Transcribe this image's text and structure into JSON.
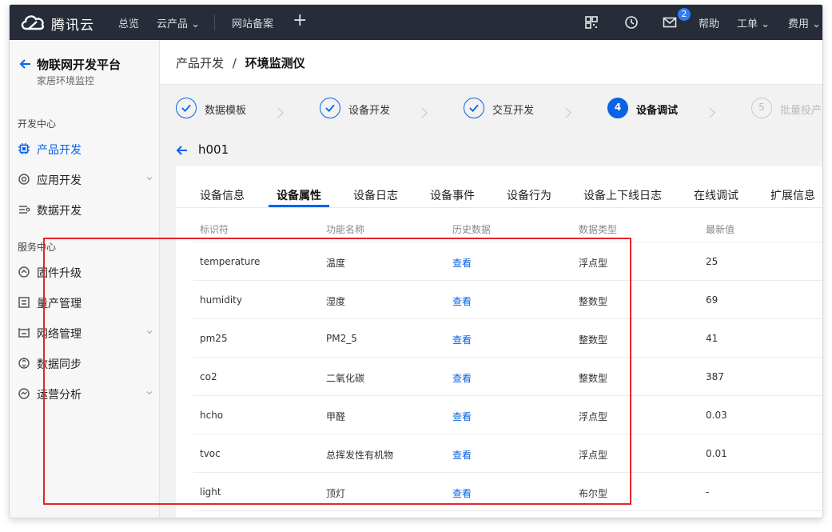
{
  "topbar": {
    "brand": "腾讯云",
    "nav": [
      {
        "label": "总览"
      },
      {
        "label": "云产品 ⌄"
      },
      {
        "label": "网站备案"
      }
    ],
    "badge_count": "2",
    "help": "帮助",
    "ticket": "工单 ⌄",
    "billing": "费用 ⌄"
  },
  "sidebar": {
    "title": "物联网开发平台",
    "subtitle": "家居环境监控",
    "dev_section": "开发中心",
    "service_section": "服务中心",
    "items": [
      {
        "label": "产品开发",
        "icon": "chip-icon"
      },
      {
        "label": "应用开发",
        "icon": "app-icon"
      },
      {
        "label": "数据开发",
        "icon": "data-flow-icon"
      },
      {
        "label": "固件升级",
        "icon": "firmware-icon"
      },
      {
        "label": "量产管理",
        "icon": "list-icon"
      },
      {
        "label": "网络管理",
        "icon": "network-icon"
      },
      {
        "label": "数据同步",
        "icon": "sync-icon"
      },
      {
        "label": "运营分析",
        "icon": "analytics-icon"
      }
    ]
  },
  "breadcrumb": {
    "parent": "产品开发",
    "separator": "/",
    "current": "环境监测仪"
  },
  "steps": [
    {
      "label": "数据模板",
      "status": "done"
    },
    {
      "label": "设备开发",
      "status": "done"
    },
    {
      "label": "交互开发",
      "status": "done"
    },
    {
      "label": "设备调试",
      "status": "current",
      "num": "4"
    },
    {
      "label": "批量投产",
      "status": "todo",
      "num": "5"
    }
  ],
  "device": {
    "name": "h001"
  },
  "tabs": [
    "设备信息",
    "设备属性",
    "设备日志",
    "设备事件",
    "设备行为",
    "设备上下线日志",
    "在线调试",
    "扩展信息"
  ],
  "table": {
    "headers": [
      "标识符",
      "功能名称",
      "历史数据",
      "数据类型",
      "最新值"
    ],
    "rows": [
      {
        "id": "temperature",
        "name": "温度",
        "history": "查看",
        "type": "浮点型",
        "value": "25"
      },
      {
        "id": "humidity",
        "name": "湿度",
        "history": "查看",
        "type": "整数型",
        "value": "69"
      },
      {
        "id": "pm25",
        "name": "PM2_5",
        "history": "查看",
        "type": "整数型",
        "value": "41"
      },
      {
        "id": "co2",
        "name": "二氧化碳",
        "history": "查看",
        "type": "整数型",
        "value": "387"
      },
      {
        "id": "hcho",
        "name": "甲醛",
        "history": "查看",
        "type": "浮点型",
        "value": "0.03"
      },
      {
        "id": "tvoc",
        "name": "总挥发性有机物",
        "history": "查看",
        "type": "浮点型",
        "value": "0.01"
      },
      {
        "id": "light",
        "name": "顶灯",
        "history": "查看",
        "type": "布尔型",
        "value": "-"
      }
    ]
  },
  "colors": {
    "accent": "#0a62e6",
    "topbar": "#262c38",
    "highlight": "#e5262c"
  }
}
